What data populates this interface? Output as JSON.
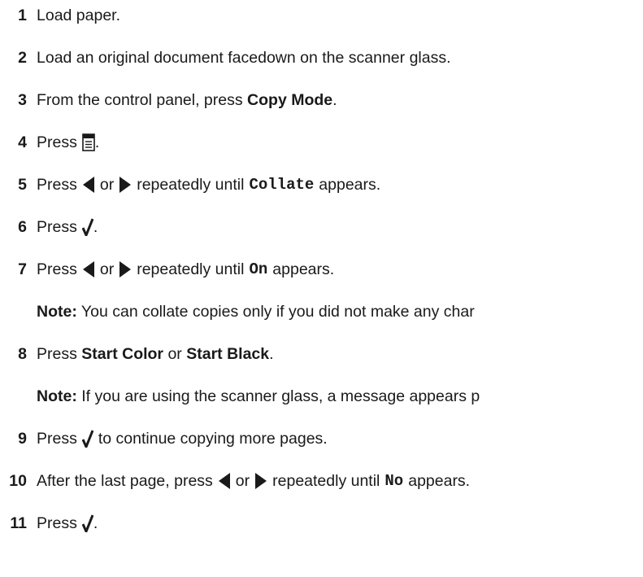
{
  "steps": [
    {
      "num": "1",
      "text": "Load paper."
    },
    {
      "num": "2",
      "text": "Load an original document facedown on the scanner glass."
    },
    {
      "num": "3",
      "pre": "From the control panel, press ",
      "bold": "Copy Mode",
      "post": "."
    },
    {
      "num": "4",
      "pre": "Press",
      "post": "."
    },
    {
      "num": "5",
      "pre": "Press",
      "mid": "or",
      "post_pre": "repeatedly until",
      "code": "Collate",
      "post": "appears."
    },
    {
      "num": "6",
      "pre": "Press",
      "post": "."
    },
    {
      "num": "7",
      "pre": "Press",
      "mid": "or",
      "post_pre": "repeatedly until",
      "code": "On",
      "post": "appears."
    },
    {
      "num": "8",
      "pre": "Press ",
      "bold1": "Start Color",
      "mid": " or ",
      "bold2": "Start Black",
      "post": "."
    },
    {
      "num": "9",
      "pre": "Press",
      "post": "to continue copying more pages."
    },
    {
      "num": "10",
      "pre": "After the last page, press",
      "mid": "or",
      "post_pre": "repeatedly until",
      "code": "No",
      "post": "appears."
    },
    {
      "num": "11",
      "pre": "Press",
      "post": "."
    }
  ],
  "notes": [
    {
      "label": "Note:",
      "text": " You can collate copies only if you did not make any char"
    },
    {
      "label": "Note:",
      "text": " If you are using the scanner glass, a message appears p"
    }
  ],
  "icons": {
    "menu": "menu-icon",
    "left": "left-arrow-icon",
    "right": "right-arrow-icon",
    "select": "checkmark-icon"
  }
}
